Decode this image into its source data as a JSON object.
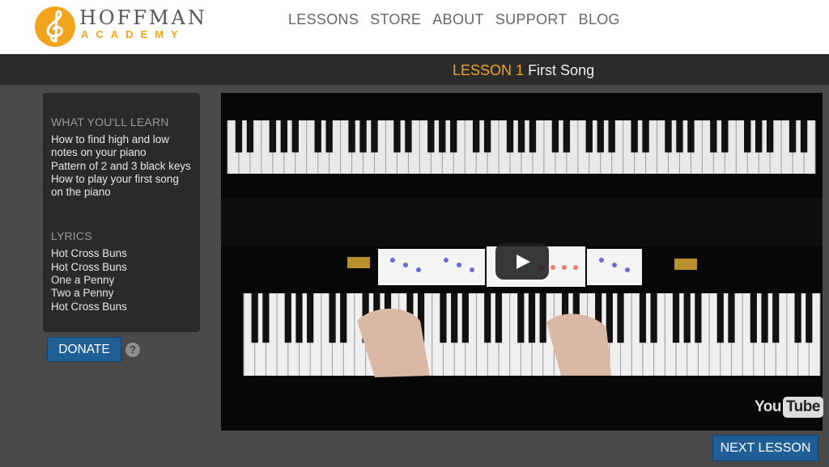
{
  "logo": {
    "title": "HOFFMAN",
    "subtitle": "ACADEMY",
    "icon": "treble-clef-logo"
  },
  "nav": {
    "items": [
      "LESSONS",
      "STORE",
      "ABOUT",
      "SUPPORT",
      "BLOG"
    ]
  },
  "lesson": {
    "number": "LESSON 1",
    "name": "First Song"
  },
  "sidebar": {
    "learn_heading": "WHAT YOU'LL LEARN",
    "learn_items": [
      "How to find high and low notes on your piano",
      "Pattern of 2 and 3 black keys",
      "How to play your first song on the piano"
    ],
    "lyrics_heading": "LYRICS",
    "lyrics": [
      "Hot Cross Buns",
      "Hot Cross Buns",
      "One a Penny",
      "Two a Penny",
      "Hot Cross Buns"
    ]
  },
  "donate": {
    "label": "DONATE",
    "help": "?"
  },
  "video": {
    "provider_you": "You",
    "provider_tube": "Tube",
    "play_icon": "play-icon"
  },
  "next_lesson": {
    "label": "NEXT LESSON"
  },
  "colors": {
    "accent": "#f2a51c",
    "button": "#1f5f95",
    "titlebar": "#2b2b2b",
    "background": "#4a4a4a"
  }
}
